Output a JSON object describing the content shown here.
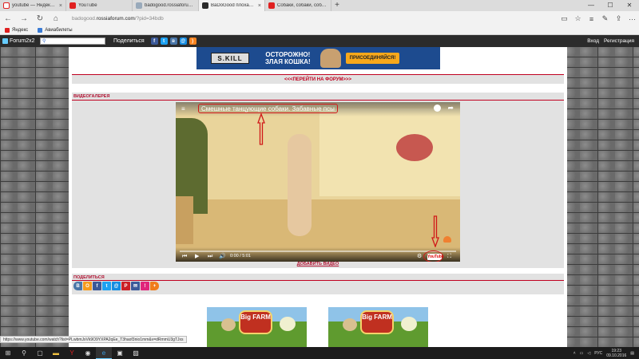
{
  "browser": {
    "tabs": [
      {
        "label": "youtube — Яндекс: нашлос",
        "favicon": "yandex",
        "active": false
      },
      {
        "label": "YouTube",
        "favicon": "youtube",
        "active": false
      },
      {
        "label": "badogood.rossiaforum.com",
        "favicon": "generic",
        "active": false
      },
      {
        "label": "BaDoGood плохая-хоро",
        "favicon": "badogood",
        "active": true
      },
      {
        "label": "Собаки, собаки, собаки. Ба",
        "favicon": "youtube",
        "active": false
      }
    ],
    "new_tab_label": "+",
    "address": {
      "prefix": "badogood.",
      "domain": "rossiaforum.com",
      "path": "/?pid=34bdb"
    },
    "bookmarks": [
      {
        "label": "Яндекс",
        "color": "#e02020"
      },
      {
        "label": "Авиабилеты",
        "color": "#3a7bd5"
      }
    ]
  },
  "forum_bar": {
    "logo": "Forum2x2",
    "search_value": "",
    "share_label": "Поделиться",
    "login": "Вход",
    "register": "Регистрация"
  },
  "page": {
    "banner": {
      "skill": "S.KILL",
      "warning_line1": "ОСТОРОЖНО!",
      "warning_line2": "ЗЛАЯ КОШКА!",
      "join": "ПРИСОЕДИНЯЙСЯ!"
    },
    "forum_link": "<<<ПЕРЕЙТИ НА ФОРУМ>>>",
    "gallery_title": "ВИДЕОГАЛЕРЕЯ",
    "video": {
      "title": "Смешные танцующие собаки. Забавные псы",
      "time": "0:00 / 5:01",
      "youtube_label": "YouTube"
    },
    "add_video": "ДОБАВИТЬ ВИДЕО",
    "share_title": "ПОДЕЛИТЬСЯ",
    "share_buttons": [
      {
        "glyph": "В",
        "color": "#4a76a8"
      },
      {
        "glyph": "О",
        "color": "#f59b1d"
      },
      {
        "glyph": "f",
        "color": "#3b5998"
      },
      {
        "glyph": "t",
        "color": "#1da1f2"
      },
      {
        "glyph": "@",
        "color": "#168de2"
      },
      {
        "glyph": "P",
        "color": "#cb2027"
      },
      {
        "glyph": "✉",
        "color": "#3d5a9a"
      },
      {
        "glyph": "!",
        "color": "#e0257b"
      },
      {
        "glyph": "+",
        "color": "#f07c1b"
      }
    ],
    "ad_text": "Big FARM"
  },
  "status_url": "https://www.youtube.com/watch?list=PLwbmJxVk9O9YXPA2qEe_T3haof3nio1mm&v=dRmmU3gTJxs",
  "taskbar": {
    "lang": "РУС",
    "time": "19:23",
    "date": "09.10.2016"
  }
}
